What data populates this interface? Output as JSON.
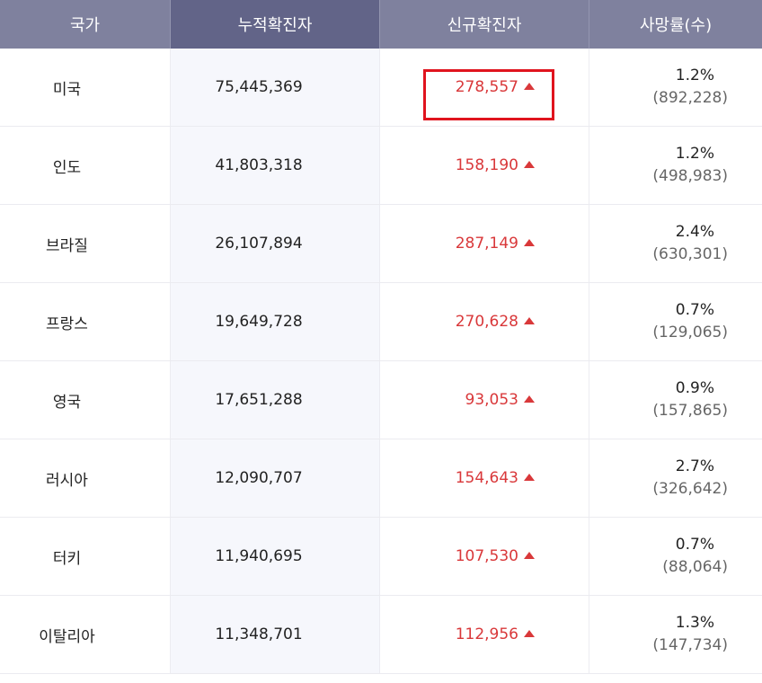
{
  "headers": {
    "country": "국가",
    "total": "누적확진자",
    "new": "신규확진자",
    "deaths": "사망률(수)"
  },
  "rows": [
    {
      "country": "미국",
      "total": "75,445,369",
      "new": "278,557",
      "rate": "1.2%",
      "deaths": "(892,228)"
    },
    {
      "country": "인도",
      "total": "41,803,318",
      "new": "158,190",
      "rate": "1.2%",
      "deaths": "(498,983)"
    },
    {
      "country": "브라질",
      "total": "26,107,894",
      "new": "287,149",
      "rate": "2.4%",
      "deaths": "(630,301)"
    },
    {
      "country": "프랑스",
      "total": "19,649,728",
      "new": "270,628",
      "rate": "0.7%",
      "deaths": "(129,065)"
    },
    {
      "country": "영국",
      "total": "17,651,288",
      "new": "93,053",
      "rate": "0.9%",
      "deaths": "(157,865)"
    },
    {
      "country": "러시아",
      "total": "12,090,707",
      "new": "154,643",
      "rate": "2.7%",
      "deaths": "(326,642)"
    },
    {
      "country": "터키",
      "total": "11,940,695",
      "new": "107,530",
      "rate": "0.7%",
      "deaths": "(88,064)"
    },
    {
      "country": "이탈리아",
      "total": "11,348,701",
      "new": "112,956",
      "rate": "1.3%",
      "deaths": "(147,734)"
    }
  ],
  "icons": {
    "increase": "triangle-up-icon"
  },
  "colors": {
    "header": "#7f819e",
    "header_active": "#626488",
    "increase": "#d9383a",
    "highlight": "#e0141e"
  }
}
